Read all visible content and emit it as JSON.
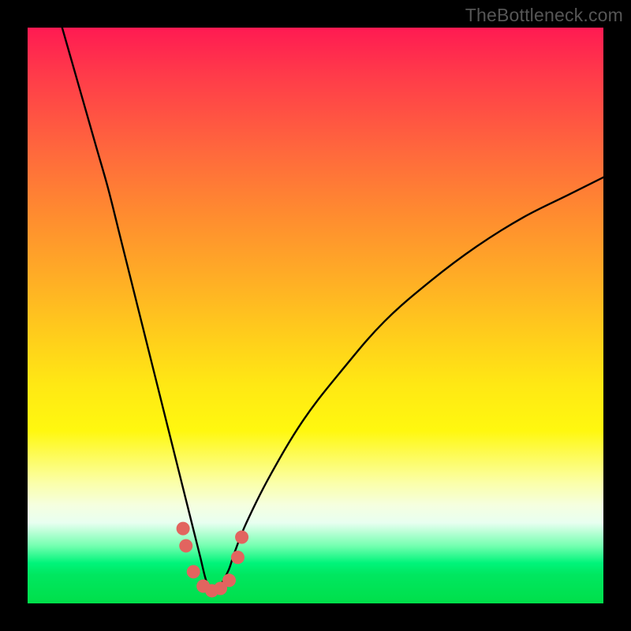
{
  "watermark": "TheBottleneck.com",
  "colors": {
    "frame": "#000000",
    "curve_stroke": "#000000",
    "marker_fill": "#e2645f",
    "gradient_top": "#ff1a52",
    "gradient_bottom": "#00df4a"
  },
  "chart_data": {
    "type": "line",
    "title": "",
    "xlabel": "",
    "ylabel": "",
    "xlim": [
      0,
      100
    ],
    "ylim": [
      0,
      100
    ],
    "note": "Axes unlabeled in source; values are relative positions (0–100) read from pixel geometry. Curve resembles a bottleneck / V-shaped loss landscape with minimum near x≈32. Red markers cluster near the valley floor.",
    "series": [
      {
        "name": "curve",
        "x": [
          6,
          8,
          10,
          12,
          14,
          16,
          18,
          20,
          22,
          24,
          26,
          28,
          29,
          30,
          31,
          32,
          33,
          34,
          35,
          36,
          38,
          42,
          48,
          55,
          62,
          70,
          78,
          86,
          94,
          100
        ],
        "y": [
          100,
          93,
          86,
          79,
          72,
          64,
          56,
          48,
          40,
          32,
          24,
          16,
          12,
          8,
          4,
          2,
          2,
          4,
          6,
          9,
          14,
          22,
          32,
          41,
          49,
          56,
          62,
          67,
          71,
          74
        ]
      }
    ],
    "markers": [
      {
        "x": 27.0,
        "y": 13.0
      },
      {
        "x": 27.5,
        "y": 10.0
      },
      {
        "x": 28.8,
        "y": 5.5
      },
      {
        "x": 30.5,
        "y": 3.0
      },
      {
        "x": 32.0,
        "y": 2.2
      },
      {
        "x": 33.5,
        "y": 2.6
      },
      {
        "x": 35.0,
        "y": 4.0
      },
      {
        "x": 36.5,
        "y": 8.0
      },
      {
        "x": 37.2,
        "y": 11.5
      }
    ]
  }
}
